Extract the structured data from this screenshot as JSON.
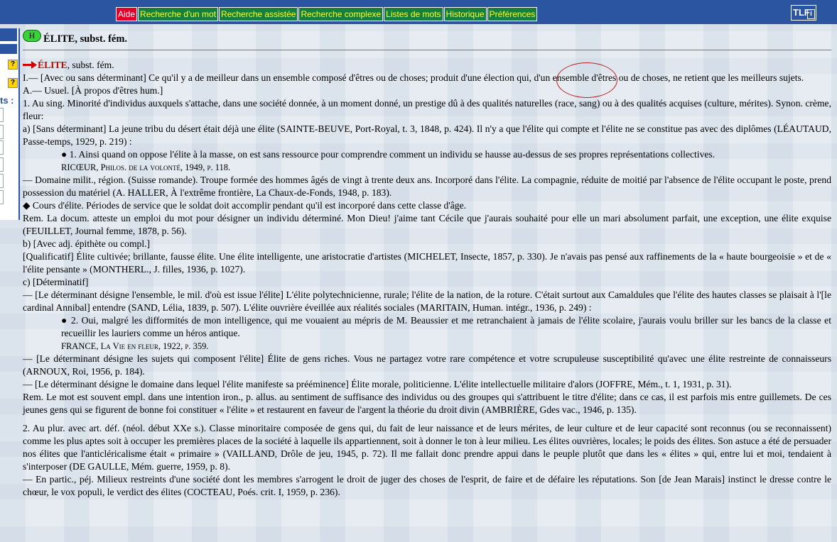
{
  "nav": {
    "aide": "Aide",
    "items": [
      "Recherche d'un mot",
      "Recherche assistée",
      "Recherche complexe",
      "Listes de mots",
      "Historique",
      "Préférences"
    ]
  },
  "logo": {
    "text": "TLF",
    "sub": "i"
  },
  "sidebar": {
    "label": "ts :",
    "help": "?"
  },
  "header": {
    "badge": "H",
    "title": "ÉLITE, subst. fém."
  },
  "entry": {
    "lemma": "ÉLITE",
    "pos": ", subst. fém.",
    "lines": [
      "I.— [Avec ou sans déterminant] Ce qu'il y a de meilleur dans un ensemble composé d'êtres ou de choses; produit d'une élection qui, d'un ensemble d'êtres ou de choses, ne retient que les meilleurs sujets.",
      "A.— Usuel. [À propos d'êtres hum.]",
      "1. Au sing. Minorité d'individus auxquels s'attache, dans une société donnée, à un moment donné, un prestige dû à des qualités naturelles (race, sang) ou à des qualités acquises (culture, mérites). Synon. crème, fleur:",
      "a) [Sans déterminant] La jeune tribu du désert était déjà une élite (SAINTE-BEUVE, Port-Royal, t. 3, 1848, p. 424). Il n'y a que l'élite qui compte et l'élite ne se constitue pas avec des diplômes (LÉAUTAUD, Passe-temps, 1929, p. 219) :",
      "● 1. Ainsi quand on oppose l'élite à la masse, on est sans ressource pour comprendre comment un individu se hausse au-dessus de ses propres représentations collectives.",
      "RICŒUR, Philos. de la volonté, 1949, p. 118.",
      "— Domaine milit., région. (Suisse romande). Troupe formée des hommes âgés de vingt à trente deux ans. Incorporé dans l'élite. La compagnie, réduite de moitié par l'absence de l'élite occupant le poste, prend possession du matériel (A. HALLER, À l'extrême frontière, La Chaux-de-Fonds, 1948, p. 183).",
      "◆ Cours d'élite. Périodes de service que le soldat doit accomplir pendant qu'il est incorporé dans cette classe d'âge.",
      "Rem. La docum. atteste un emploi du mot pour désigner un individu déterminé. Mon Dieu! j'aime tant Cécile que j'aurais souhaité pour elle un mari absolument parfait, une exception, une élite exquise (FEUILLET, Journal femme, 1878, p. 56).",
      "b) [Avec adj. épithète ou compl.]",
      "[Qualificatif] Élite cultivée; brillante, fausse élite. Une élite intelligente, une aristocratie d'artistes (MICHELET, Insecte, 1857, p. 330). Je n'avais pas pensé aux raffinements de la « haute bourgeoisie » et de « l'élite pensante » (MONTHERL., J. filles, 1936, p. 1027).",
      "c) [Déterminatif]",
      "— [Le déterminant désigne l'ensemble, le mil. d'où est issue l'élite] L'élite polytechnicienne, rurale; l'élite de la nation, de la roture. C'était surtout aux Camaldules que l'élite des hautes classes se plaisait à l'[le cardinal Annibal] entendre (SAND, Lélia, 1839, p. 507). L'élite ouvrière éveillée aux réalités sociales (MARITAIN, Human. intégr., 1936, p. 249) :",
      "● 2. Oui, malgré les difformités de mon intelligence, qui me vouaient au mépris de M. Beaussier et me retranchaient à jamais de l'élite scolaire, j'aurais voulu briller sur les bancs de la classe et recueillir les lauriers comme un héros antique.",
      "FRANCE, La Vie en fleur, 1922, p. 359.",
      "— [Le déterminant désigne les sujets qui composent l'élite] Élite de gens riches. Vous ne partagez votre rare compétence et votre scrupuleuse susceptibilité qu'avec une élite restreinte de connaisseurs (ARNOUX, Roi, 1956, p. 184).",
      "— [Le déterminant désigne le domaine dans lequel l'élite manifeste sa prééminence] Élite morale, politicienne. L'élite intellectuelle militaire d'alors (JOFFRE, Mém., t. 1, 1931, p. 31).",
      "Rem. Le mot est souvent empl. dans une intention iron., p. allus. au sentiment de suffisance des individus ou des groupes qui s'attribuent le titre d'élite; dans ce cas, il est parfois mis entre guillemets. De ces jeunes gens qui se figurent de bonne foi constituer « l'élite » et restaurent en faveur de l'argent la théorie du droit divin (AMBRIÈRE, Gdes vac., 1946, p. 135).",
      "2. Au plur. avec art. déf. (néol. début XXe s.). Classe minoritaire composée de gens qui, du fait de leur naissance et de leurs mérites, de leur culture et de leur capacité sont reconnus (ou se reconnaissent) comme les plus aptes soit à occuper les premières places de la société à laquelle ils appartiennent, soit à donner le ton à leur milieu. Les élites ouvrières, locales; le poids des élites. Son astuce a été de persuader nos élites que l'anticléricalisme était « primaire » (VAILLAND, Drôle de jeu, 1945, p. 72). Il me fallait donc prendre appui dans le peuple plutôt que dans les « élites » qui, entre lui et moi, tendaient à s'interposer (DE GAULLE, Mém. guerre, 1959, p. 8).",
      "— En partic., péj. Milieux restreints d'une société dont les membres s'arrogent le droit de juger des choses de l'esprit, de faire et de défaire les réputations. Son [de Jean Marais] instinct le dresse contre le chœur, le vox populi, le verdict des élites (COCTEAU, Poés. crit. I, 1959, p. 236)."
    ]
  }
}
